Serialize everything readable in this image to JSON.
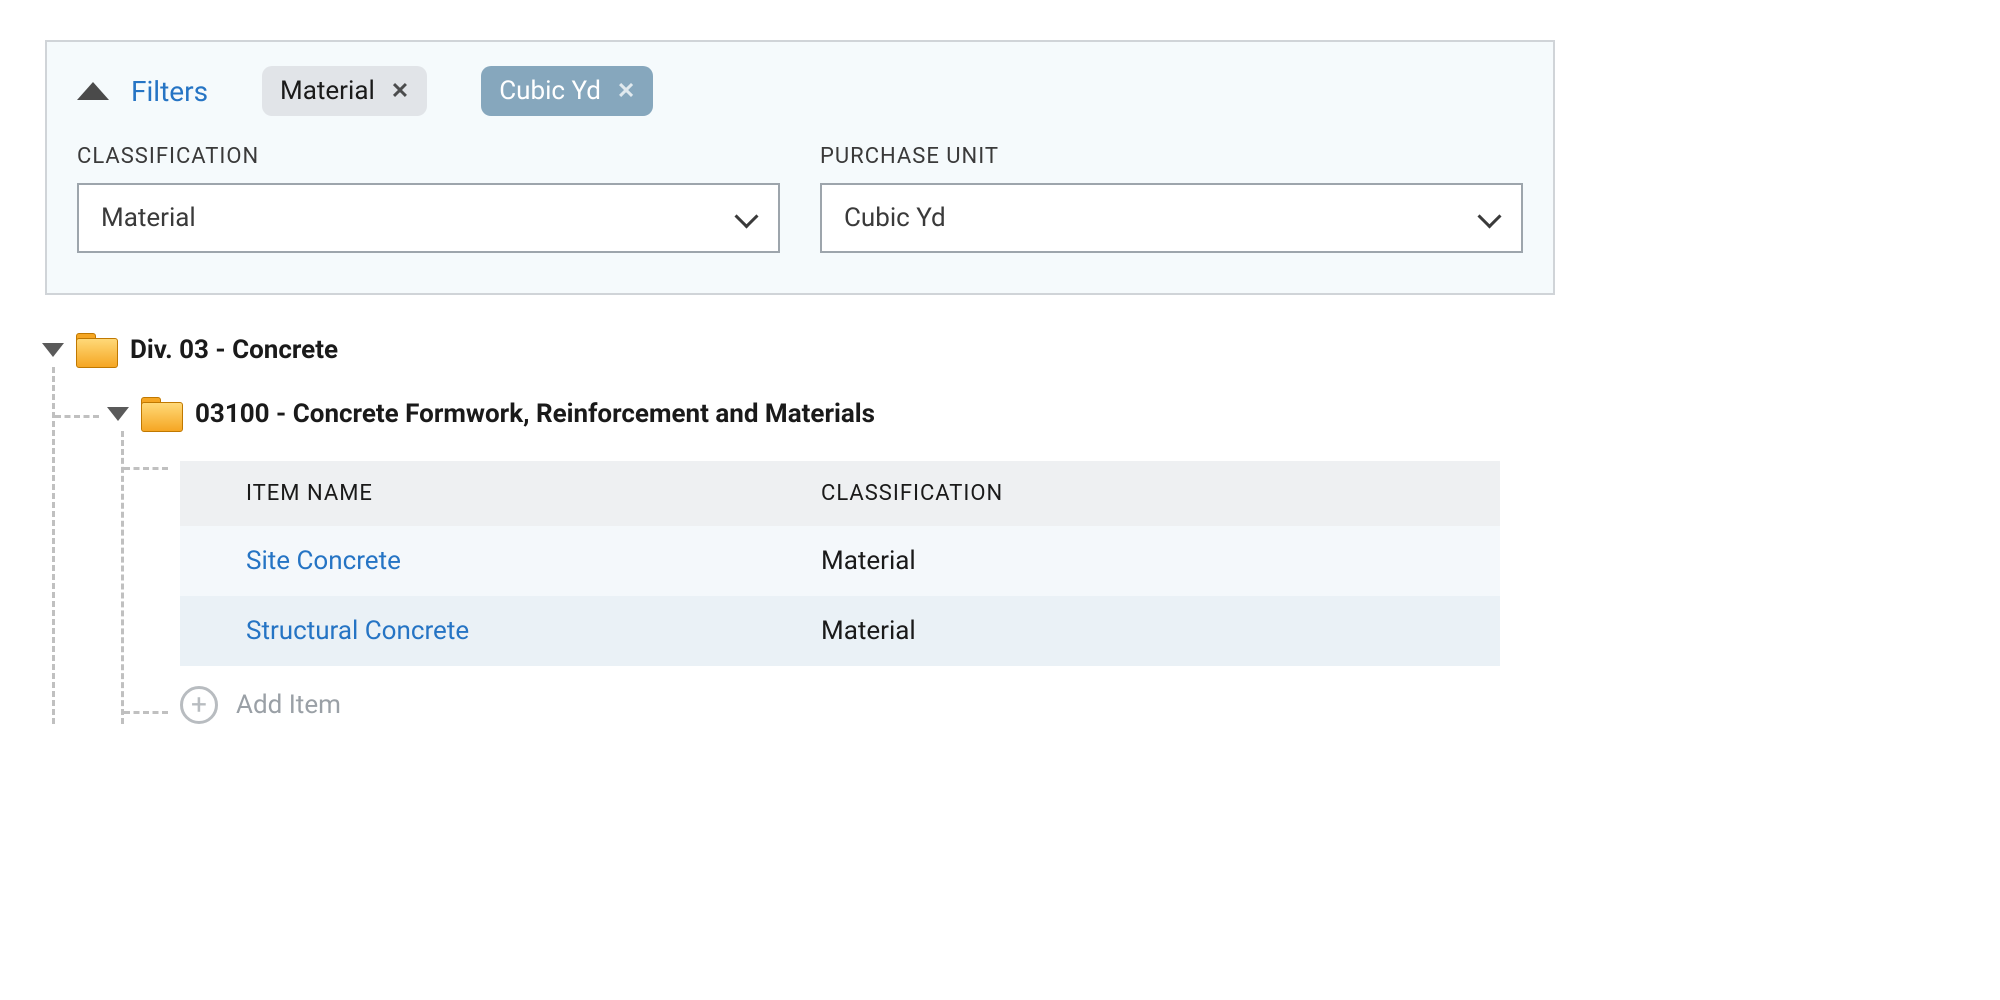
{
  "filters": {
    "label": "Filters",
    "chips": [
      {
        "label": "Material"
      },
      {
        "label": "Cubic Yd"
      }
    ],
    "fields": {
      "classification": {
        "header": "CLASSIFICATION",
        "value": "Material"
      },
      "purchase_unit": {
        "header": "PURCHASE UNIT",
        "value": "Cubic Yd"
      }
    }
  },
  "tree": {
    "root": {
      "label": "Div. 03 - Concrete"
    },
    "child": {
      "label": "03100 - Concrete Formwork, Reinforcement and Materials"
    },
    "table": {
      "headers": {
        "name": "ITEM NAME",
        "classification": "CLASSIFICATION"
      },
      "rows": [
        {
          "name": "Site Concrete",
          "classification": "Material"
        },
        {
          "name": "Structural Concrete",
          "classification": "Material"
        }
      ]
    },
    "add_item_label": "Add Item"
  }
}
